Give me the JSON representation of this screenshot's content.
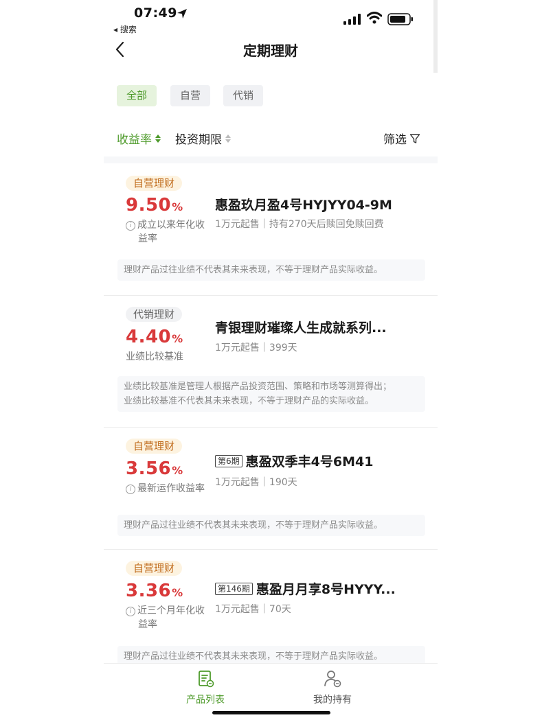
{
  "status_bar": {
    "time": "07:49",
    "back_label": "◂ 搜索"
  },
  "nav": {
    "title": "定期理财"
  },
  "filters": [
    {
      "label": "全部",
      "active": true
    },
    {
      "label": "自营",
      "active": false
    },
    {
      "label": "代销",
      "active": false
    }
  ],
  "sort": {
    "yield_label": "收益率",
    "term_label": "投资期限",
    "filter_label": "筛选"
  },
  "products": [
    {
      "tag": "自营理财",
      "rate": "9.50",
      "unit": "%",
      "rate_label_1": "成立以来年化收",
      "rate_label_2": "益率",
      "issue": "",
      "name": "惠盈玖月盈4号HYJYY04-9M",
      "meta": "1万元起售｜持有270天后赎回免赎回费",
      "note": "理财产品过往业绩不代表其未来表现，不等于理财产品实际收益。"
    },
    {
      "tag": "代销理财",
      "rate": "4.40",
      "unit": "%",
      "rate_label_1": "业绩比较基准",
      "rate_label_2": "",
      "issue": "",
      "name": "青银理财璀璨人生成就系列...",
      "meta": "1万元起售｜399天",
      "note_line_1": "业绩比较基准是管理人根据产品投资范围、策略和市场等测算得出；",
      "note_line_2": "业绩比较基准不代表其未来表现，不等于理财产品的实际收益。"
    },
    {
      "tag": "自营理财",
      "rate": "3.56",
      "unit": "%",
      "rate_label_1": "最新运作收益率",
      "rate_label_2": "",
      "issue": "第6期",
      "name": "惠盈双季丰4号6M41",
      "meta": "1万元起售｜190天",
      "note": "理财产品过往业绩不代表其未来表现，不等于理财产品实际收益。"
    },
    {
      "tag": "自营理财",
      "rate": "3.36",
      "unit": "%",
      "rate_label_1": "近三个月年化收",
      "rate_label_2": "益率",
      "issue": "第146期",
      "name": "惠盈月月享8号HYYY...",
      "meta": "1万元起售｜70天",
      "note": "理财产品过往业绩不代表其未来表现，不等于理财产品实际收益。"
    }
  ],
  "tabbar": {
    "tab1": "产品列表",
    "tab2": "我的持有"
  },
  "colors": {
    "accent_green": "#4d9a2a",
    "rate_red": "#d9393a",
    "tag_self_text": "#c06b1b"
  }
}
